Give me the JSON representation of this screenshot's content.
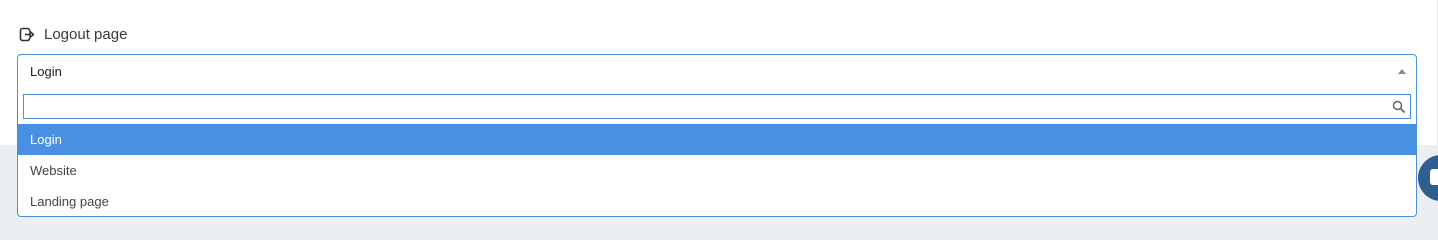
{
  "field": {
    "label": "Logout page",
    "icon": "logout-icon"
  },
  "select": {
    "selected_value": "Login",
    "arrow_icon": "caret-up-icon"
  },
  "dropdown": {
    "search_placeholder": "",
    "search_icon": "search-icon",
    "options": [
      {
        "label": "Login",
        "selected": true
      },
      {
        "label": "Website",
        "selected": false
      },
      {
        "label": "Landing page",
        "selected": false
      }
    ]
  },
  "chat_widget": {
    "icon": "chat-icon"
  },
  "colors": {
    "accent": "#4a90e2",
    "chat": "#2f5f8e",
    "page_bg": "#eceff2"
  }
}
